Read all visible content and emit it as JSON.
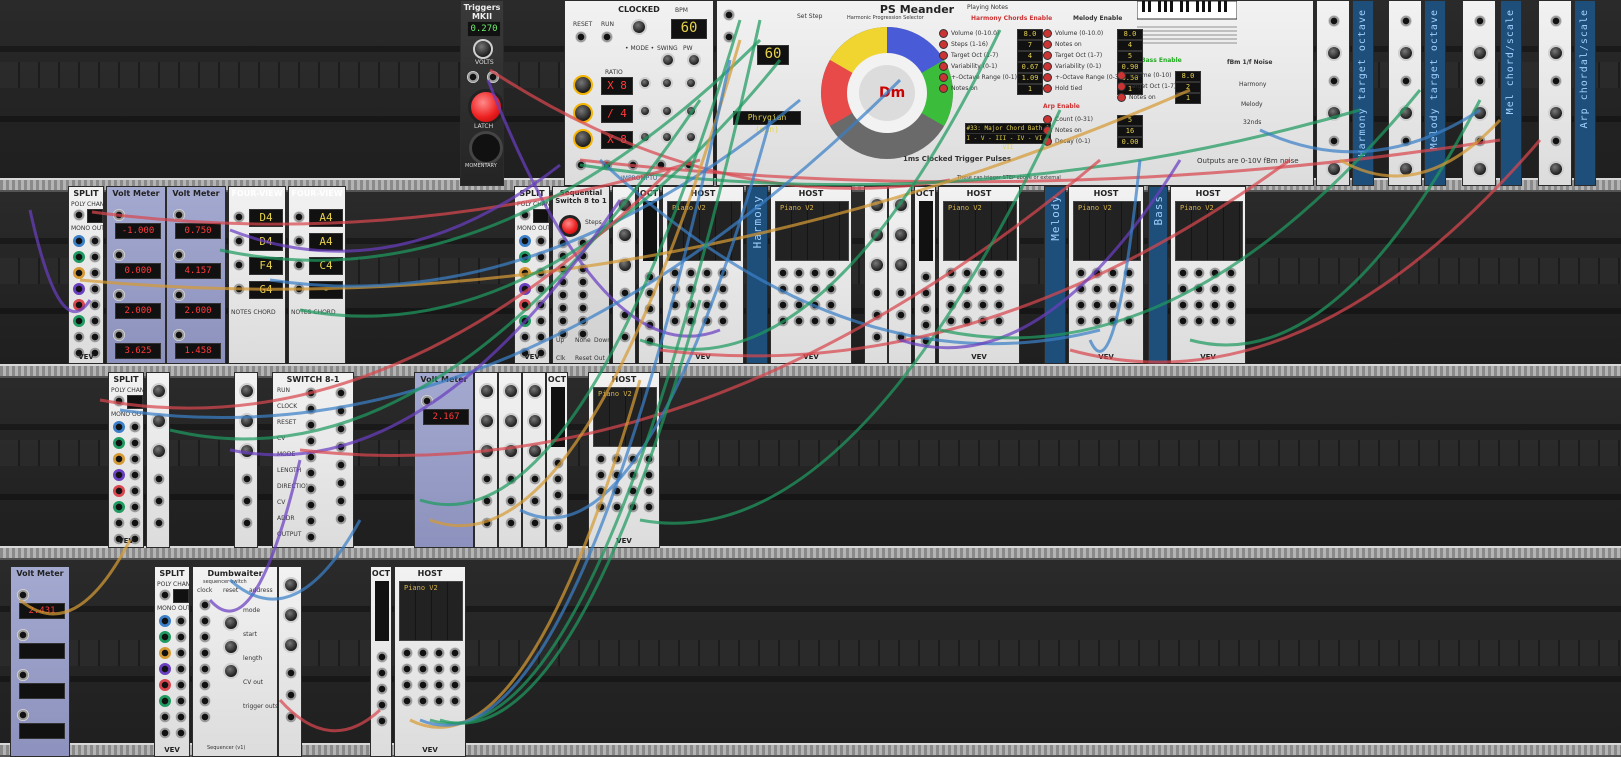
{
  "colors": {
    "red": "#d8464e",
    "green": "#1f9a60",
    "blue": "#3a7fc8",
    "purple": "#6a3fc0",
    "orange": "#d59a34",
    "teal": "#2aa39a"
  },
  "modules": {
    "triggers": {
      "title": "Triggers MKII",
      "display": "0.270",
      "volts": "VOLTS",
      "latch": "LATCH",
      "momentary": "MOMENTARY"
    },
    "clocked": {
      "title": "CLOCKED",
      "bpm_label": "BPM",
      "bpm": "60",
      "reset": "RESET",
      "run": "RUN",
      "mode": "• MODE •",
      "swing": "SWING",
      "pw": "PW",
      "clk": "CLK",
      "ratio_label": "RATIO",
      "ratios": [
        "X 8",
        "/ 4",
        "X 8"
      ],
      "footer": "IMPROMPTU"
    },
    "meander": {
      "title": "PS Meander",
      "subtitle": "Harmonic Progression Selector",
      "bpm": "60",
      "key": "Dm",
      "circle_notes": [
        "C",
        "G",
        "D",
        "A",
        "E",
        "B",
        "F#",
        "Db",
        "Ab",
        "Eb",
        "Bb",
        "F"
      ],
      "mode_label": "Phrygian (min)",
      "progression": "#33: Major Chord Bath 1",
      "progression_steps": "I - V - III - IV - VI - VII",
      "set_step": "Set Step",
      "pulse_label": "1ms Clocked Trigger Pulses",
      "pulse_note": "These can trigger STEP above or external",
      "playing_notes": "Playing Notes",
      "outputs_note": "Outputs are 0-10V fBm noise"
    },
    "meander_harmony": {
      "enable": "Harmony Chords Enable",
      "rows": [
        {
          "label": "Volume (0-10.0)",
          "value": "8.0"
        },
        {
          "label": "Steps (1-16)",
          "value": "7"
        },
        {
          "label": "Target Oct (1-7)",
          "value": "4"
        },
        {
          "label": "Variability (0-1)",
          "value": "0.67"
        },
        {
          "label": "+-Octave Range (0-1)",
          "value": "1.09"
        },
        {
          "label": "Notes on",
          "value": "1"
        }
      ],
      "toggles": [
        "Nice 7ths",
        "V 7ths",
        "Staccato",
        "Progression Presets"
      ]
    },
    "meander_melody": {
      "enable": "Melody Enable",
      "rows": [
        {
          "label": "Volume (0-10.0)",
          "value": "8.0"
        },
        {
          "label": "Notes on",
          "value": "4"
        },
        {
          "label": "Target Oct (1-7)",
          "value": "5"
        },
        {
          "label": "Variability (0-1)",
          "value": "0.90"
        },
        {
          "label": "+-Octave Range (0-3)",
          "value": "0.50"
        },
        {
          "label": "Hold tied",
          "value": "1"
        }
      ],
      "toggles": [
        "Chordal",
        "Scaler",
        "Staccato"
      ]
    },
    "meander_arp": {
      "enable": "Arp Enable",
      "rows": [
        {
          "label": "Count (0-31)",
          "value": "5"
        },
        {
          "label": "Notes on",
          "value": "16"
        },
        {
          "label": "Decay (0-1)",
          "value": "0.00"
        }
      ],
      "display": "ArpSet"
    },
    "meander_bass": {
      "enable": "Bass Enable",
      "rows": [
        {
          "label": "Volume (0-10)",
          "value": "8.0"
        },
        {
          "label": "Target Oct (1-7)",
          "value": "2"
        },
        {
          "label": "Notes on",
          "value": "1"
        }
      ],
      "toggles": [
        "Staccato",
        "Accent",
        "Syncopate",
        "Shuffle",
        "Octaves"
      ]
    },
    "meander_fbm": {
      "title": "fBm 1/f Noise",
      "harmony": "Harmony",
      "melody": "Melody",
      "arp": "32nds",
      "rows": [
        {
          "label": "Octaves (1-6)",
          "value": "3"
        },
        {
          "label": "Period Sec (1-100)",
          "value": "60.0"
        }
      ]
    },
    "vertical_labels": [
      "Harmony target octave",
      "Melody target octave",
      "Mel chord/scale",
      "Arp chordal/scale",
      "Bass target octave",
      "Harmony",
      "Melody",
      "Bass"
    ],
    "volt_meters": [
      {
        "title": "Volt Meter",
        "values": [
          "-1.000",
          "0.000",
          "2.000",
          "3.625"
        ]
      },
      {
        "title": "Volt Meter",
        "values": [
          "0.750",
          "4.157",
          "2.000",
          "1.458"
        ]
      },
      {
        "title": "Volt Meter",
        "values": [
          "2.167"
        ]
      },
      {
        "title": "Volt Meter",
        "values": [
          "2.431",
          "",
          "",
          ""
        ]
      }
    ],
    "four_views": [
      {
        "title": "FOUR-VIEW",
        "notes": [
          "D4",
          "D4",
          "F4",
          "G4"
        ],
        "footer": "NOTES  CHORD"
      },
      {
        "title": "FOUR-VIEW",
        "notes": [
          "A4",
          "A4",
          "C4",
          "-"
        ],
        "footer": "NOTES  CHORD"
      }
    ],
    "split": {
      "title": "SPLIT",
      "poly": "POLY",
      "chan": "CHAN",
      "mono_out": "MONO OUT"
    },
    "seq_switch": {
      "title": "Sequential Switch 8 to 1",
      "steps": "Steps",
      "up": "Up",
      "none": "None",
      "down": "Down",
      "reset": "Reset",
      "clk": "Clk",
      "out": "Out"
    },
    "switch81": {
      "title": "SWITCH 8-1",
      "labels": [
        "RUN",
        "CLOCK",
        "RESET",
        "CV",
        "MODE",
        "LENGTH",
        "DIRECTION",
        "CV",
        "ADDR",
        "OUTPUT"
      ]
    },
    "dumbwaiter": {
      "title": "Dumbwaiter",
      "subtitle": "sequencer switch",
      "labels": [
        "clock",
        "reset",
        "address",
        "mode",
        "start",
        "length",
        "CV out",
        "trigger outs"
      ],
      "footer": "Sequencer (v1)"
    },
    "host": {
      "title": "HOST",
      "plugin": "Piano V2"
    },
    "oct": {
      "title": "OCT"
    },
    "vev": "VEV"
  }
}
